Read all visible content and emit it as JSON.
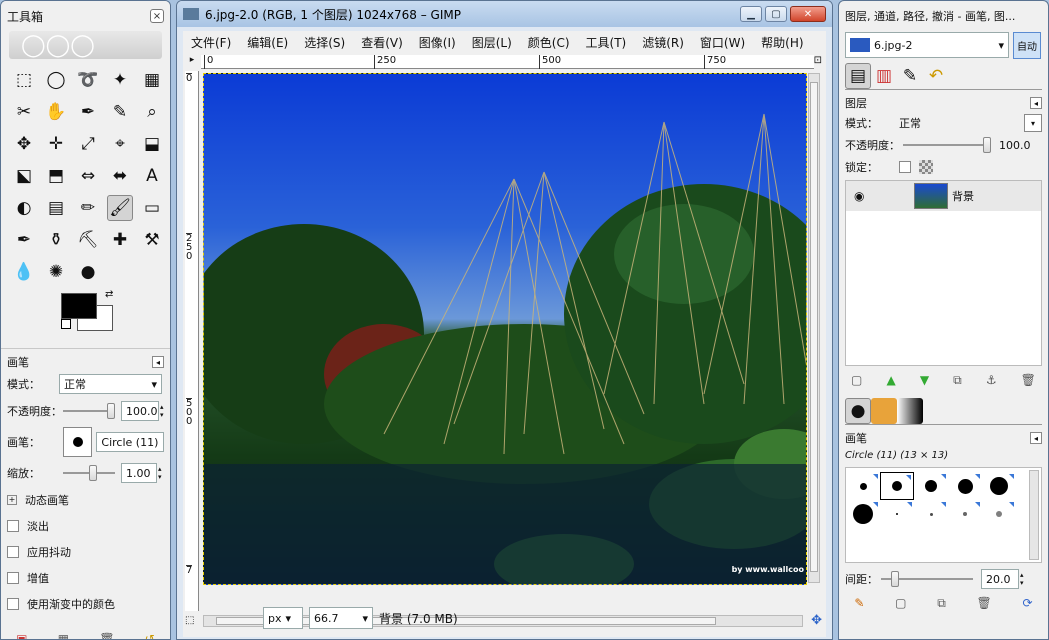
{
  "toolbox": {
    "title": "工具箱",
    "tools": [
      "⬚",
      "◯",
      "➰",
      "✦",
      "▦",
      "✂",
      "✋",
      "✒",
      "✎",
      "⌕",
      "✥",
      "✛",
      "⤢",
      "⌖",
      "⬓",
      "⬕",
      "⬒",
      "⇔",
      "⬌",
      "A",
      "◐",
      "▤",
      "✏",
      "🖌",
      "▭",
      "✒",
      "⚱",
      "⛏",
      "✚",
      "⚒",
      "💧",
      "✺",
      "●"
    ],
    "brush_title": "画笔",
    "mode_label": "模式：",
    "mode_value": "正常",
    "opacity_label": "不透明度：",
    "opacity_value": "100.0",
    "brush_label": "画笔：",
    "brush_value": "Circle (11)",
    "scale_label": "缩放：",
    "scale_value": "1.00",
    "dynamic_label": "动态画笔",
    "options": [
      "淡出",
      "应用抖动",
      "增值",
      "使用渐变中的颜色"
    ]
  },
  "image_window": {
    "title": "6.jpg-2.0 (RGB, 1 个图层) 1024x768 – GIMP",
    "menus": [
      "文件(F)",
      "编辑(E)",
      "选择(S)",
      "查看(V)",
      "图像(I)",
      "图层(L)",
      "颜色(C)",
      "工具(T)",
      "滤镜(R)",
      "窗口(W)",
      "帮助(H)"
    ],
    "ruler_ticks": [
      "0",
      "250",
      "500",
      "750"
    ],
    "vruler_ticks": [
      "0",
      "2\n5\n0",
      "5\n0\n0",
      "7"
    ],
    "unit": "px",
    "zoom": "66.7",
    "status": "背景 (7.0 MB)",
    "watermark": "by www.wallcoo"
  },
  "layers_window": {
    "title": "图层, 通道, 路径, 撤消 - 画笔, 图...",
    "image_select": "6.jpg-2",
    "auto_label": "自动",
    "layers_title": "图层",
    "mode_label": "模式：",
    "mode_value": "正常",
    "opacity_label": "不透明度：",
    "opacity_value": "100.0",
    "lock_label": "锁定：",
    "layer_name": "背景",
    "brushes_title": "画笔",
    "brush_info": "Circle (11) (13 × 13)",
    "spacing_label": "间距：",
    "spacing_value": "20.0"
  },
  "colors": {
    "accent": "#3b78d8",
    "fg": "#000000",
    "bg": "#ffffff"
  }
}
